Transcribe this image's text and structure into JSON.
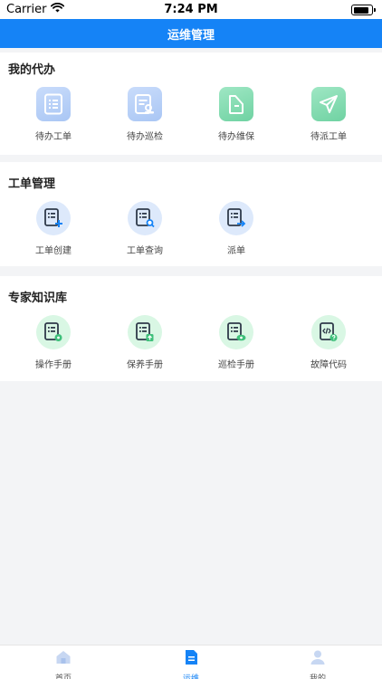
{
  "status": {
    "carrier": "Carrier",
    "time": "7:24 PM"
  },
  "header": {
    "title": "运维管理"
  },
  "sections": [
    {
      "title": "我的代办",
      "items": [
        {
          "label": "待办工单",
          "icon": "document-list-icon"
        },
        {
          "label": "待办巡检",
          "icon": "inspection-icon"
        },
        {
          "label": "待办维保",
          "icon": "maintenance-icon"
        },
        {
          "label": "待派工单",
          "icon": "send-icon"
        }
      ]
    },
    {
      "title": "工单管理",
      "items": [
        {
          "label": "工单创建",
          "icon": "order-create-icon"
        },
        {
          "label": "工单查询",
          "icon": "order-search-icon"
        },
        {
          "label": "派单",
          "icon": "order-dispatch-icon"
        }
      ]
    },
    {
      "title": "专家知识库",
      "items": [
        {
          "label": "操作手册",
          "icon": "operation-manual-icon"
        },
        {
          "label": "保养手册",
          "icon": "maintenance-manual-icon"
        },
        {
          "label": "巡检手册",
          "icon": "inspection-manual-icon"
        },
        {
          "label": "故障代码",
          "icon": "fault-code-icon"
        }
      ]
    }
  ],
  "tabs": [
    {
      "label": "首页",
      "icon": "home-icon"
    },
    {
      "label": "运维",
      "icon": "document-icon",
      "active": true
    },
    {
      "label": "我的",
      "icon": "user-icon"
    }
  ],
  "colors": {
    "primary": "#1583f6",
    "green": "#3ec07a",
    "background": "#f3f4f6"
  }
}
